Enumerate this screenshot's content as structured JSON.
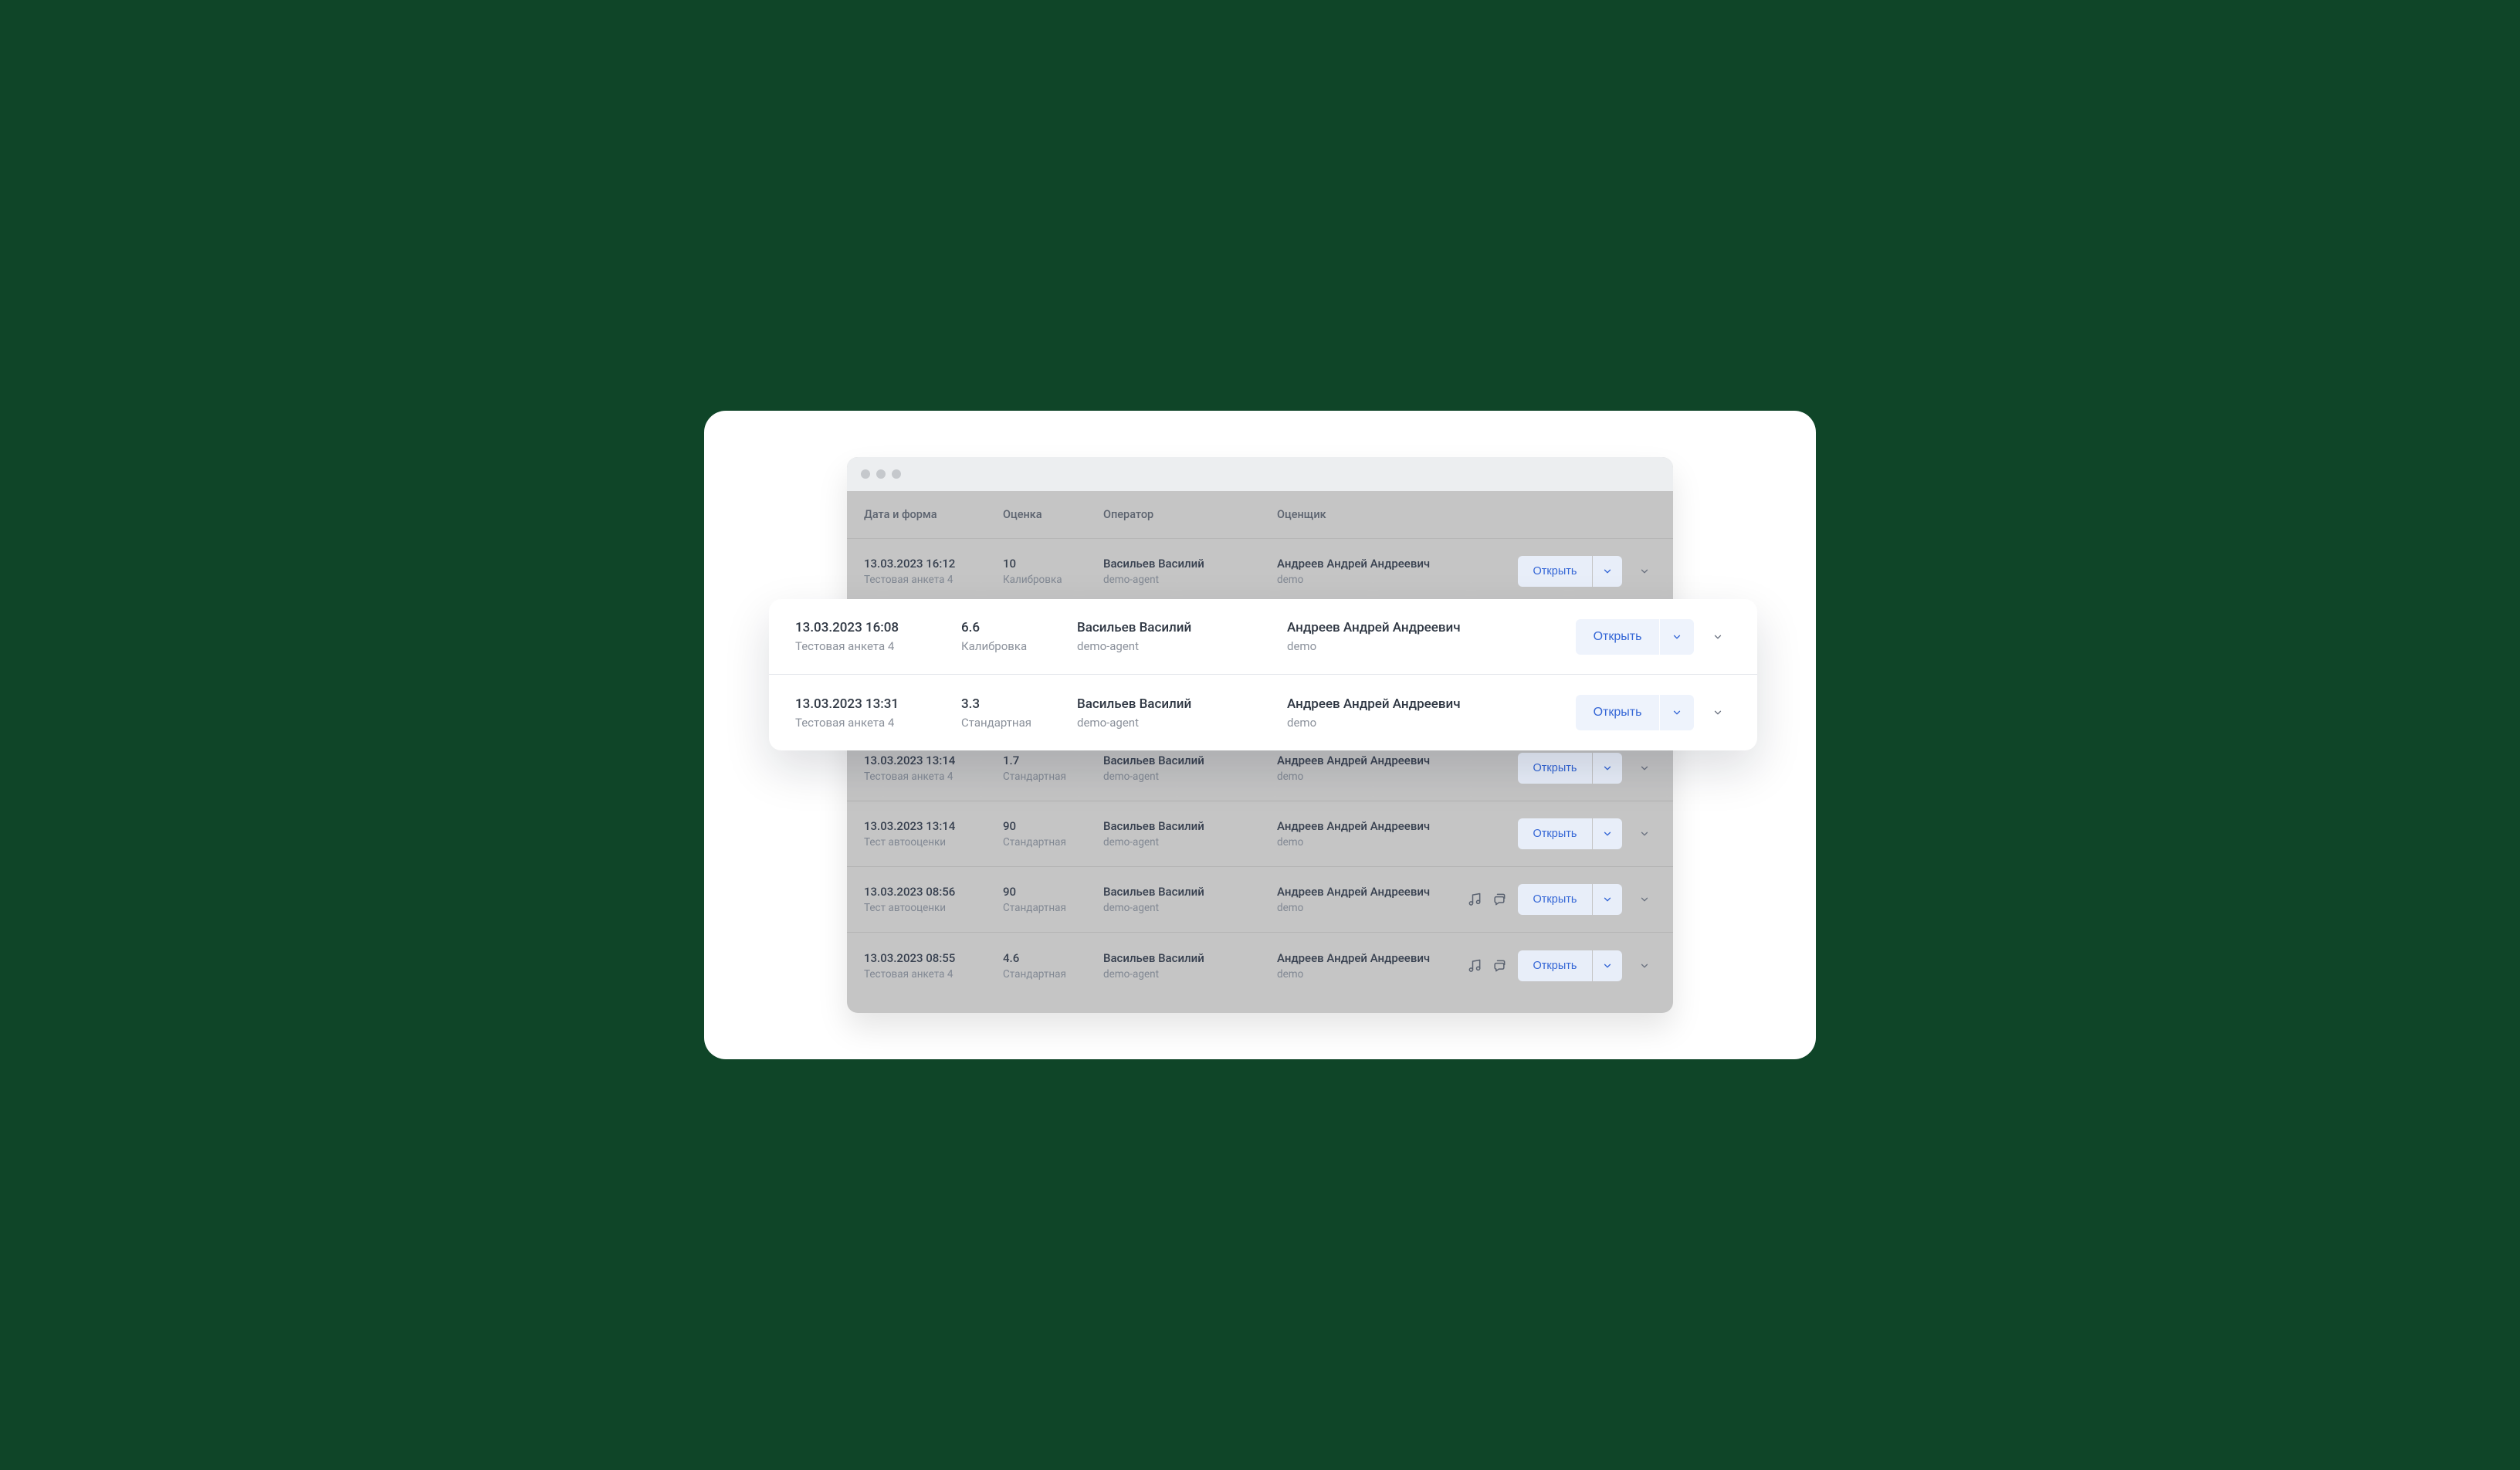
{
  "columns": {
    "date_form": "Дата и форма",
    "score": "Оценка",
    "operator": "Оператор",
    "evaluator": "Оценщик"
  },
  "open_label": "Открыть",
  "base_rows": [
    {
      "datetime": "13.03.2023 16:12",
      "form": "Тестовая анкета 4",
      "score": "10",
      "score_type": "Калибровка",
      "operator_name": "Васильев Василий",
      "operator_sub": "demo-agent",
      "evaluator_name": "Андреев Андрей Андреевич",
      "evaluator_sub": "demo",
      "has_audio": false,
      "has_chat": false
    },
    {
      "datetime": "",
      "form": "",
      "score": "",
      "score_type": "",
      "operator_name": "",
      "operator_sub": "",
      "evaluator_name": "",
      "evaluator_sub": "",
      "has_audio": false,
      "has_chat": false
    },
    {
      "datetime": "",
      "form": "",
      "score": "",
      "score_type": "",
      "operator_name": "",
      "operator_sub": "",
      "evaluator_name": "",
      "evaluator_sub": "",
      "has_audio": false,
      "has_chat": false
    },
    {
      "datetime": "13.03.2023 13:14",
      "form": "Тестовая анкета 4",
      "score": "1.7",
      "score_type": "Стандартная",
      "operator_name": "Васильев Василий",
      "operator_sub": "demo-agent",
      "evaluator_name": "Андреев Андрей Андреевич",
      "evaluator_sub": "demo",
      "has_audio": false,
      "has_chat": false
    },
    {
      "datetime": "13.03.2023 13:14",
      "form": "Тест автооценки",
      "score": "90",
      "score_type": "Стандартная",
      "operator_name": "Васильев Василий",
      "operator_sub": "demo-agent",
      "evaluator_name": "Андреев Андрей Андреевич",
      "evaluator_sub": "demo",
      "has_audio": false,
      "has_chat": false
    },
    {
      "datetime": "13.03.2023 08:56",
      "form": "Тест автооценки",
      "score": "90",
      "score_type": "Стандартная",
      "operator_name": "Васильев Василий",
      "operator_sub": "demo-agent",
      "evaluator_name": "Андреев Андрей Андреевич",
      "evaluator_sub": "demo",
      "has_audio": true,
      "has_chat": true
    },
    {
      "datetime": "13.03.2023 08:55",
      "form": "Тестовая анкета 4",
      "score": "4.6",
      "score_type": "Стандартная",
      "operator_name": "Васильев Василий",
      "operator_sub": "demo-agent",
      "evaluator_name": "Андреев Андрей Андреевич",
      "evaluator_sub": "demo",
      "has_audio": true,
      "has_chat": true
    }
  ],
  "pop_rows": [
    {
      "datetime": "13.03.2023 16:08",
      "form": "Тестовая анкета 4",
      "score": "6.6",
      "score_type": "Калибровка",
      "operator_name": "Васильев Василий",
      "operator_sub": "demo-agent",
      "evaluator_name": "Андреев Андрей Андреевич",
      "evaluator_sub": "demo"
    },
    {
      "datetime": "13.03.2023 13:31",
      "form": "Тестовая анкета 4",
      "score": "3.3",
      "score_type": "Стандартная",
      "operator_name": "Васильев Василий",
      "operator_sub": "demo-agent",
      "evaluator_name": "Андреев Андрей Андреевич",
      "evaluator_sub": "demo"
    }
  ]
}
